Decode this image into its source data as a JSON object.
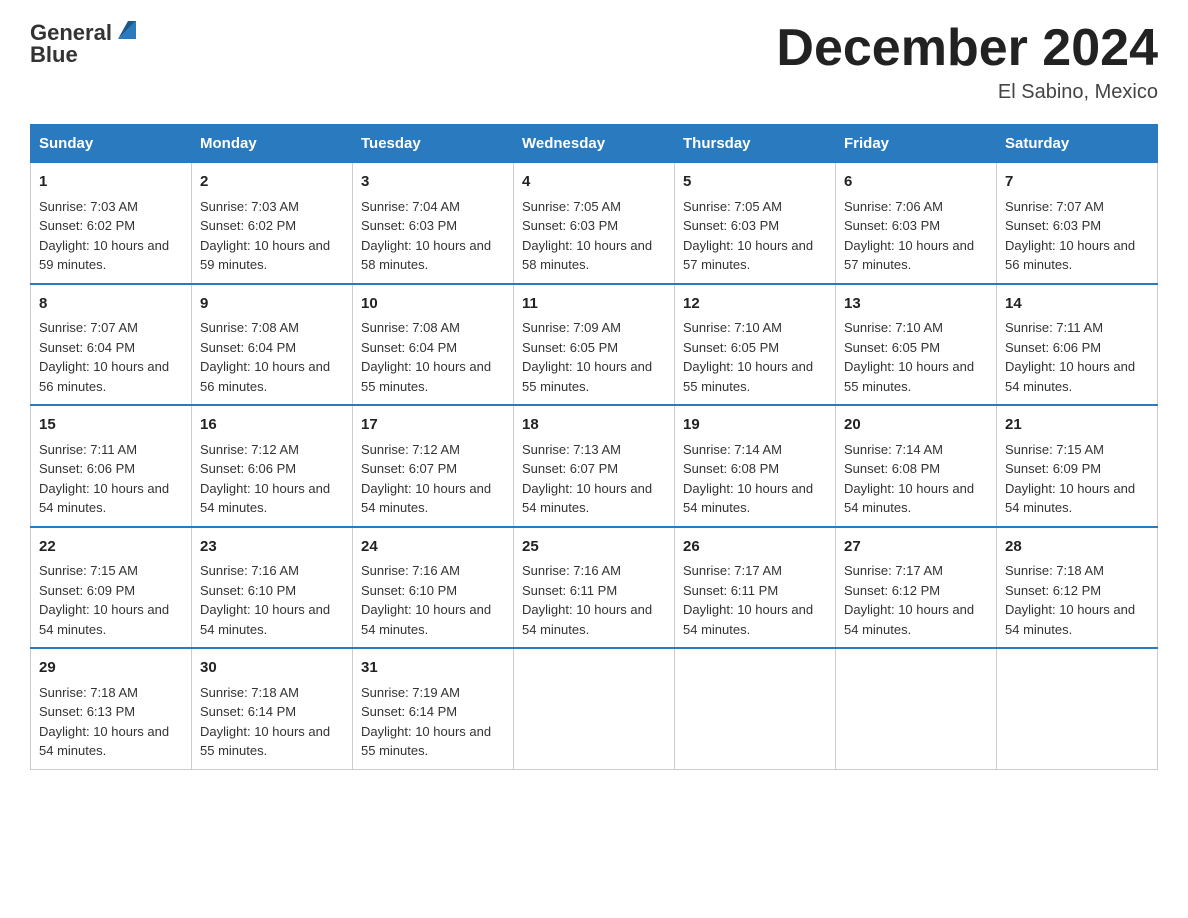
{
  "header": {
    "logo_general": "General",
    "logo_blue": "Blue",
    "month_title": "December 2024",
    "location": "El Sabino, Mexico"
  },
  "days_of_week": [
    "Sunday",
    "Monday",
    "Tuesday",
    "Wednesday",
    "Thursday",
    "Friday",
    "Saturday"
  ],
  "weeks": [
    [
      {
        "day": "1",
        "sunrise": "Sunrise: 7:03 AM",
        "sunset": "Sunset: 6:02 PM",
        "daylight": "Daylight: 10 hours and 59 minutes."
      },
      {
        "day": "2",
        "sunrise": "Sunrise: 7:03 AM",
        "sunset": "Sunset: 6:02 PM",
        "daylight": "Daylight: 10 hours and 59 minutes."
      },
      {
        "day": "3",
        "sunrise": "Sunrise: 7:04 AM",
        "sunset": "Sunset: 6:03 PM",
        "daylight": "Daylight: 10 hours and 58 minutes."
      },
      {
        "day": "4",
        "sunrise": "Sunrise: 7:05 AM",
        "sunset": "Sunset: 6:03 PM",
        "daylight": "Daylight: 10 hours and 58 minutes."
      },
      {
        "day": "5",
        "sunrise": "Sunrise: 7:05 AM",
        "sunset": "Sunset: 6:03 PM",
        "daylight": "Daylight: 10 hours and 57 minutes."
      },
      {
        "day": "6",
        "sunrise": "Sunrise: 7:06 AM",
        "sunset": "Sunset: 6:03 PM",
        "daylight": "Daylight: 10 hours and 57 minutes."
      },
      {
        "day": "7",
        "sunrise": "Sunrise: 7:07 AM",
        "sunset": "Sunset: 6:03 PM",
        "daylight": "Daylight: 10 hours and 56 minutes."
      }
    ],
    [
      {
        "day": "8",
        "sunrise": "Sunrise: 7:07 AM",
        "sunset": "Sunset: 6:04 PM",
        "daylight": "Daylight: 10 hours and 56 minutes."
      },
      {
        "day": "9",
        "sunrise": "Sunrise: 7:08 AM",
        "sunset": "Sunset: 6:04 PM",
        "daylight": "Daylight: 10 hours and 56 minutes."
      },
      {
        "day": "10",
        "sunrise": "Sunrise: 7:08 AM",
        "sunset": "Sunset: 6:04 PM",
        "daylight": "Daylight: 10 hours and 55 minutes."
      },
      {
        "day": "11",
        "sunrise": "Sunrise: 7:09 AM",
        "sunset": "Sunset: 6:05 PM",
        "daylight": "Daylight: 10 hours and 55 minutes."
      },
      {
        "day": "12",
        "sunrise": "Sunrise: 7:10 AM",
        "sunset": "Sunset: 6:05 PM",
        "daylight": "Daylight: 10 hours and 55 minutes."
      },
      {
        "day": "13",
        "sunrise": "Sunrise: 7:10 AM",
        "sunset": "Sunset: 6:05 PM",
        "daylight": "Daylight: 10 hours and 55 minutes."
      },
      {
        "day": "14",
        "sunrise": "Sunrise: 7:11 AM",
        "sunset": "Sunset: 6:06 PM",
        "daylight": "Daylight: 10 hours and 54 minutes."
      }
    ],
    [
      {
        "day": "15",
        "sunrise": "Sunrise: 7:11 AM",
        "sunset": "Sunset: 6:06 PM",
        "daylight": "Daylight: 10 hours and 54 minutes."
      },
      {
        "day": "16",
        "sunrise": "Sunrise: 7:12 AM",
        "sunset": "Sunset: 6:06 PM",
        "daylight": "Daylight: 10 hours and 54 minutes."
      },
      {
        "day": "17",
        "sunrise": "Sunrise: 7:12 AM",
        "sunset": "Sunset: 6:07 PM",
        "daylight": "Daylight: 10 hours and 54 minutes."
      },
      {
        "day": "18",
        "sunrise": "Sunrise: 7:13 AM",
        "sunset": "Sunset: 6:07 PM",
        "daylight": "Daylight: 10 hours and 54 minutes."
      },
      {
        "day": "19",
        "sunrise": "Sunrise: 7:14 AM",
        "sunset": "Sunset: 6:08 PM",
        "daylight": "Daylight: 10 hours and 54 minutes."
      },
      {
        "day": "20",
        "sunrise": "Sunrise: 7:14 AM",
        "sunset": "Sunset: 6:08 PM",
        "daylight": "Daylight: 10 hours and 54 minutes."
      },
      {
        "day": "21",
        "sunrise": "Sunrise: 7:15 AM",
        "sunset": "Sunset: 6:09 PM",
        "daylight": "Daylight: 10 hours and 54 minutes."
      }
    ],
    [
      {
        "day": "22",
        "sunrise": "Sunrise: 7:15 AM",
        "sunset": "Sunset: 6:09 PM",
        "daylight": "Daylight: 10 hours and 54 minutes."
      },
      {
        "day": "23",
        "sunrise": "Sunrise: 7:16 AM",
        "sunset": "Sunset: 6:10 PM",
        "daylight": "Daylight: 10 hours and 54 minutes."
      },
      {
        "day": "24",
        "sunrise": "Sunrise: 7:16 AM",
        "sunset": "Sunset: 6:10 PM",
        "daylight": "Daylight: 10 hours and 54 minutes."
      },
      {
        "day": "25",
        "sunrise": "Sunrise: 7:16 AM",
        "sunset": "Sunset: 6:11 PM",
        "daylight": "Daylight: 10 hours and 54 minutes."
      },
      {
        "day": "26",
        "sunrise": "Sunrise: 7:17 AM",
        "sunset": "Sunset: 6:11 PM",
        "daylight": "Daylight: 10 hours and 54 minutes."
      },
      {
        "day": "27",
        "sunrise": "Sunrise: 7:17 AM",
        "sunset": "Sunset: 6:12 PM",
        "daylight": "Daylight: 10 hours and 54 minutes."
      },
      {
        "day": "28",
        "sunrise": "Sunrise: 7:18 AM",
        "sunset": "Sunset: 6:12 PM",
        "daylight": "Daylight: 10 hours and 54 minutes."
      }
    ],
    [
      {
        "day": "29",
        "sunrise": "Sunrise: 7:18 AM",
        "sunset": "Sunset: 6:13 PM",
        "daylight": "Daylight: 10 hours and 54 minutes."
      },
      {
        "day": "30",
        "sunrise": "Sunrise: 7:18 AM",
        "sunset": "Sunset: 6:14 PM",
        "daylight": "Daylight: 10 hours and 55 minutes."
      },
      {
        "day": "31",
        "sunrise": "Sunrise: 7:19 AM",
        "sunset": "Sunset: 6:14 PM",
        "daylight": "Daylight: 10 hours and 55 minutes."
      },
      null,
      null,
      null,
      null
    ]
  ]
}
